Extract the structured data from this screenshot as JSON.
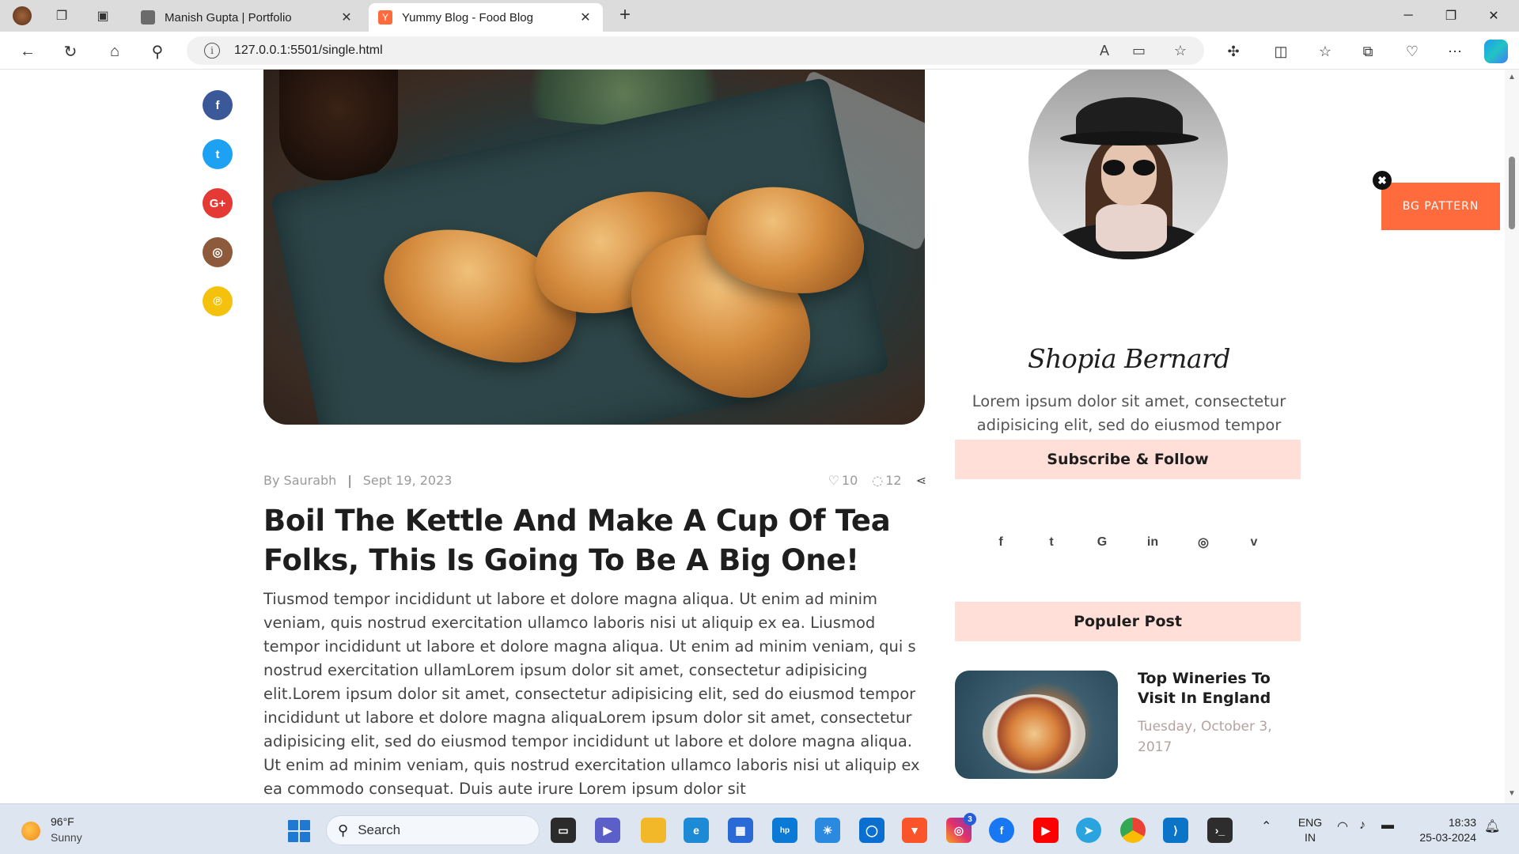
{
  "browser": {
    "tabs": [
      {
        "title": "Manish Gupta | Portfolio",
        "active": false
      },
      {
        "title": "Yummy Blog - Food Blog",
        "active": true
      }
    ],
    "new_tab": "+",
    "url": "127.0.0.1:5501/single.html",
    "window_controls": {
      "minimize": "─",
      "restore": "❐",
      "close": "✕"
    }
  },
  "page": {
    "share_icons": [
      "facebook-icon",
      "twitter-icon",
      "google-plus-icon",
      "instagram-icon",
      "pinterest-icon"
    ],
    "share_glyphs": [
      "f",
      "t",
      "G+",
      "◎",
      "℗"
    ],
    "share_colors": [
      "#3b5998",
      "#1da1f2",
      "#e53935",
      "#8d5a3b",
      "#f4c20d"
    ],
    "post": {
      "author": "By Saurabh",
      "separator": "|",
      "date": "Sept 19, 2023",
      "likes": "10",
      "comments": "12",
      "title": "Boil The Kettle And Make A Cup Of Tea Folks, This Is Going To Be A Big One!",
      "body": "Tiusmod tempor incididunt ut labore et dolore magna aliqua. Ut enim ad minim veniam, quis nostrud exercitation ullamco laboris nisi ut aliquip ex ea. Liusmod tempor incididunt ut labore et dolore magna aliqua. Ut enim ad minim veniam, qui s nostrud exercitation ullamLorem ipsum dolor sit amet, consectetur adipisicing elit.Lorem ipsum dolor sit amet, consectetur adipisicing elit, sed do eiusmod tempor incididunt ut labore et dolore magna aliquaLorem ipsum dolor sit amet, consectetur adipisicing elit, sed do eiusmod tempor incididunt ut labore et dolore magna aliqua. Ut enim ad minim veniam, quis nostrud exercitation ullamco laboris nisi ut aliquip ex ea commodo consequat. Duis aute irure Lorem ipsum dolor sit"
    },
    "sidebar": {
      "author_name": "Shopia Bernard",
      "author_bio": "Lorem ipsum dolor sit amet, consectetur adipisicing elit, sed do eiusmod tempor incididunt",
      "subscribe_heading": "Subscribe & Follow",
      "follow_icons": [
        "facebook-icon",
        "twitter-icon",
        "google-icon",
        "linkedin-icon",
        "instagram-icon",
        "vimeo-icon"
      ],
      "follow_glyphs": [
        "f",
        "t",
        "G",
        "in",
        "◎",
        "v"
      ],
      "popular_heading": "Populer Post",
      "popular_post": {
        "title": "Top Wineries To Visit In England",
        "date": "Tuesday, October 3, 2017"
      }
    },
    "bg_pattern": {
      "label": "BG PATTERN",
      "close": "✖"
    }
  },
  "taskbar": {
    "weather": {
      "temp": "96°F",
      "condition": "Sunny"
    },
    "search_placeholder": "Search",
    "badge": "3",
    "language": {
      "line1": "ENG",
      "line2": "IN"
    },
    "clock": {
      "time": "18:33",
      "date": "25-03-2024"
    }
  },
  "colors": {
    "accent": "#ff6b3d",
    "widget_heading_bg": "#ffdfd7",
    "meta_text": "#9a9a9a"
  }
}
